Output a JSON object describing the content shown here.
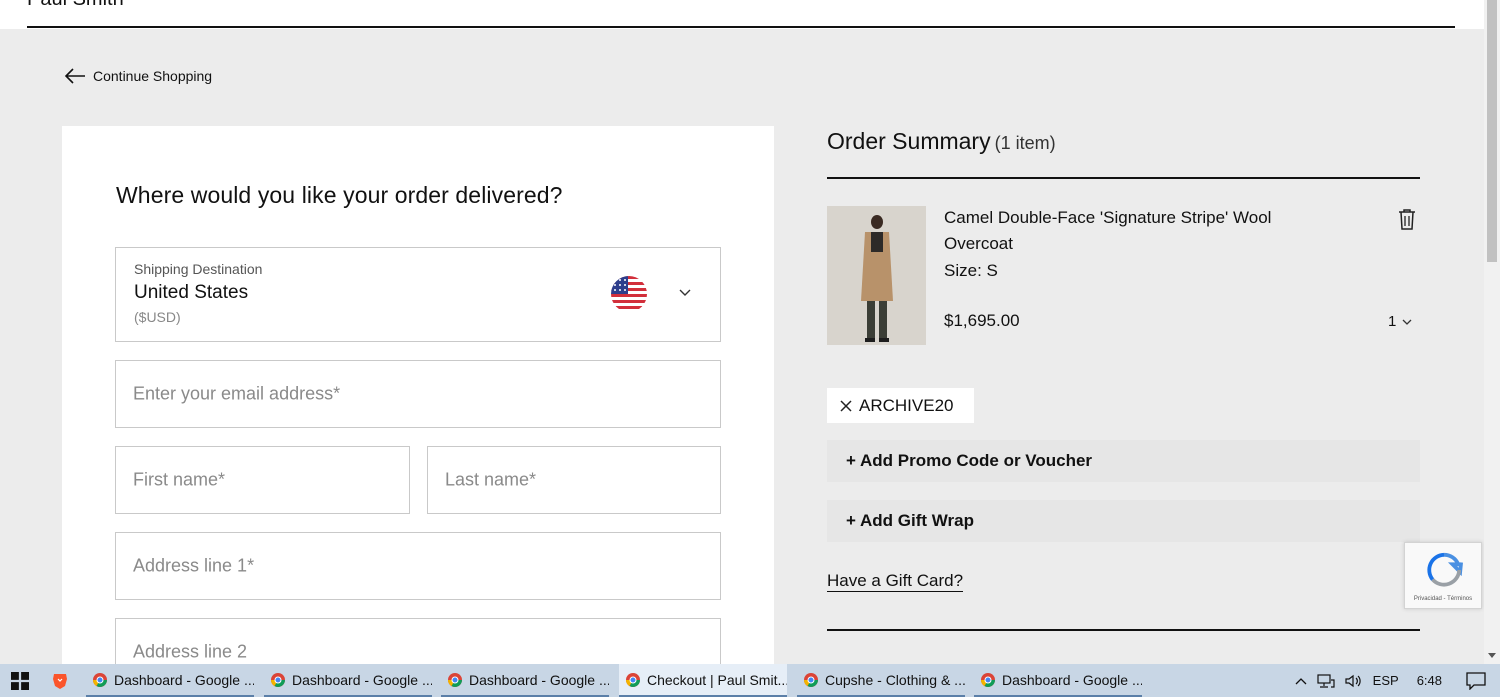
{
  "header": {
    "cut_text": "Paul Smith"
  },
  "nav": {
    "back_label": "Continue Shopping"
  },
  "form": {
    "title": "Where would you like your order delivered?",
    "destination": {
      "label": "Shipping Destination",
      "country": "United States",
      "currency": "($USD)",
      "flag_icon": "us-flag-icon"
    },
    "email_placeholder": "Enter your email address*",
    "first_name_placeholder": "First name*",
    "last_name_placeholder": "Last name*",
    "address1_placeholder": "Address line 1*",
    "address2_placeholder": "Address line 2"
  },
  "summary": {
    "title": "Order Summary",
    "count": "(1 item)",
    "item": {
      "name": "Camel Double-Face 'Signature Stripe' Wool Overcoat",
      "size": "Size: S",
      "price": "$1,695.00",
      "qty": "1"
    },
    "applied_code": "ARCHIVE20",
    "promo_label": "+ Add Promo Code or Voucher",
    "gift_wrap_label": "+ Add Gift Wrap",
    "gift_card_label": "Have a Gift Card?"
  },
  "recaptcha": {
    "text": "Privacidad - Términos"
  },
  "taskbar": {
    "tasks": [
      {
        "label": "Dashboard - Google ..."
      },
      {
        "label": "Dashboard - Google ..."
      },
      {
        "label": "Dashboard - Google ..."
      },
      {
        "label": "Checkout | Paul Smit..."
      },
      {
        "label": "Cupshe - Clothing & ..."
      },
      {
        "label": "Dashboard - Google ..."
      }
    ],
    "lang": "ESP",
    "time": "6:48"
  },
  "colors": {
    "background": "#ececec",
    "panel": "#ffffff",
    "taskbar": "#c8d6e5",
    "text": "#111111"
  }
}
